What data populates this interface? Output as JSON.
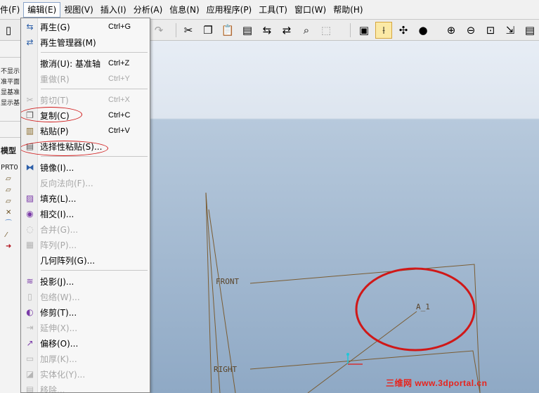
{
  "menubar": {
    "items": [
      {
        "label": "件(F)"
      },
      {
        "label": "编辑(E)"
      },
      {
        "label": "视图(V)"
      },
      {
        "label": "插入(I)"
      },
      {
        "label": "分析(A)"
      },
      {
        "label": "信息(N)"
      },
      {
        "label": "应用程序(P)"
      },
      {
        "label": "工具(T)"
      },
      {
        "label": "窗口(W)"
      },
      {
        "label": "帮助(H)"
      }
    ]
  },
  "edit_menu": {
    "items": [
      {
        "label": "再生(G)",
        "shortcut": "Ctrl+G"
      },
      {
        "label": "再生管理器(M)",
        "shortcut": ""
      },
      {
        "label": "撤消(U): 基准轴",
        "shortcut": "Ctrl+Z"
      },
      {
        "label": "重做(R)",
        "shortcut": "Ctrl+Y"
      },
      {
        "label": "剪切(T)",
        "shortcut": "Ctrl+X"
      },
      {
        "label": "复制(C)",
        "shortcut": "Ctrl+C"
      },
      {
        "label": "粘贴(P)",
        "shortcut": "Ctrl+V"
      },
      {
        "label": "选择性粘贴(S)...",
        "shortcut": ""
      },
      {
        "label": "镜像(I)...",
        "shortcut": ""
      },
      {
        "label": "反向法向(F)...",
        "shortcut": ""
      },
      {
        "label": "填充(L)...",
        "shortcut": ""
      },
      {
        "label": "相交(I)...",
        "shortcut": ""
      },
      {
        "label": "合并(G)...",
        "shortcut": ""
      },
      {
        "label": "阵列(P)...",
        "shortcut": ""
      },
      {
        "label": "几何阵列(G)...",
        "shortcut": ""
      },
      {
        "label": "投影(J)...",
        "shortcut": ""
      },
      {
        "label": "包络(W)...",
        "shortcut": ""
      },
      {
        "label": "修剪(T)...",
        "shortcut": ""
      },
      {
        "label": "延伸(X)...",
        "shortcut": ""
      },
      {
        "label": "偏移(O)...",
        "shortcut": ""
      },
      {
        "label": "加厚(K)...",
        "shortcut": ""
      },
      {
        "label": "实体化(Y)...",
        "shortcut": ""
      },
      {
        "label": "移除...",
        "shortcut": ""
      }
    ]
  },
  "left_panel": {
    "lines": [
      "不显示",
      "准平面",
      "显基准",
      "显示基"
    ],
    "tab_label": "模型",
    "tree_root": "PRT0"
  },
  "graphics": {
    "labels": {
      "front": "FRONT",
      "axis": "A_1",
      "right": "RIGHT"
    }
  },
  "watermark": "三维网 www.3dportal.cn",
  "colors": {
    "highlight_oval": "#d01818",
    "datum_line": "#7a5c32"
  }
}
